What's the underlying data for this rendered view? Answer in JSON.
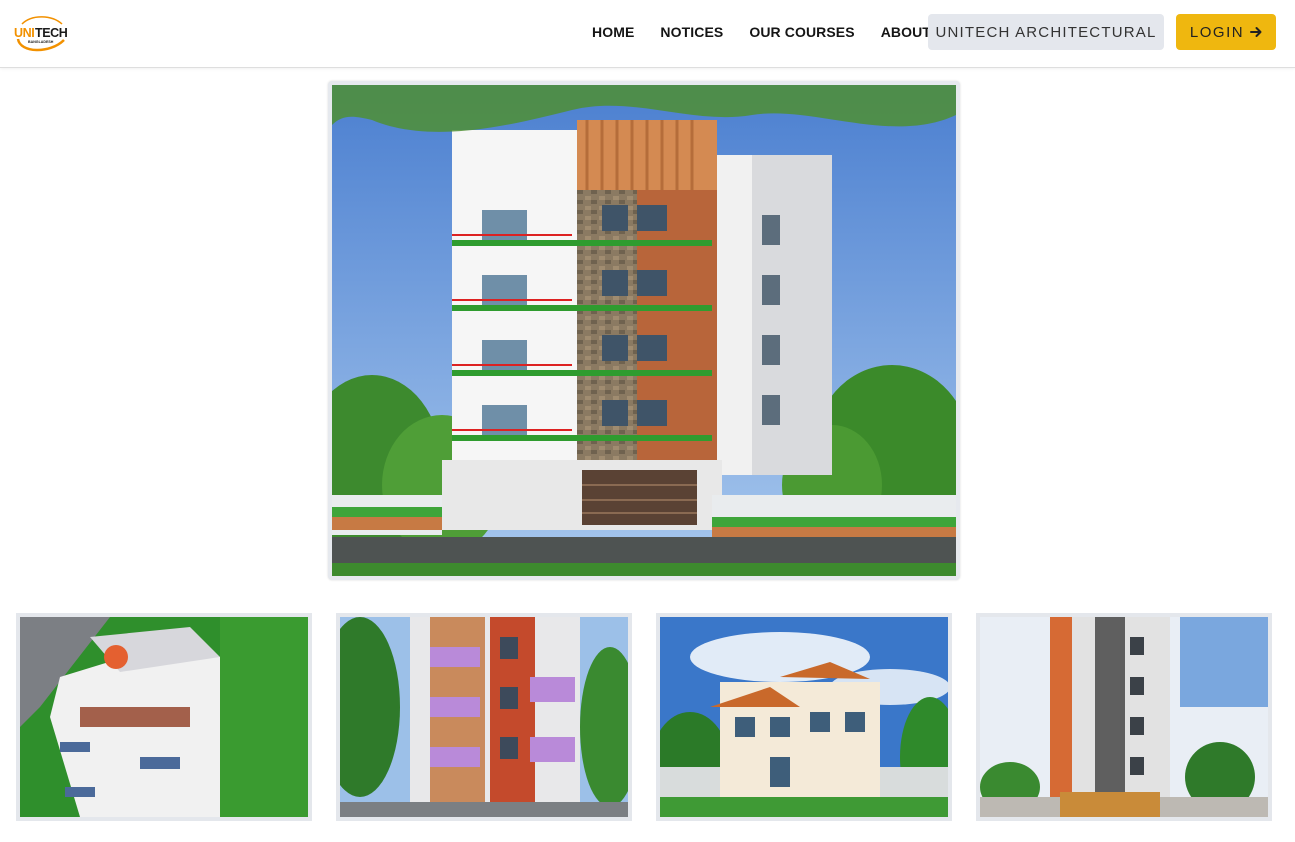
{
  "brand": {
    "logo_text": "UNITECH",
    "logo_subtext": "BANGLADESH",
    "logo_color": "#f29100",
    "logo_dark": "#1b1b1b"
  },
  "nav": {
    "links": [
      {
        "label": "HOME"
      },
      {
        "label": "NOTICES"
      },
      {
        "label": "OUR COURSES"
      },
      {
        "label": "ABOUT"
      }
    ],
    "architectural_button": "UNITECH ARCHITECTURAL",
    "login_button": "LOGIN",
    "login_icon": "arrow-right-icon"
  },
  "colors": {
    "accent": "#efb70f",
    "secondary_button": "#e4e7ed",
    "frame": "#e6e9ee"
  },
  "gallery": {
    "hero": {
      "subject": "multi-storey-apartment-render"
    },
    "thumbnails": [
      {
        "subject": "rooftop-garden-building-render"
      },
      {
        "subject": "colorful-apartment-render"
      },
      {
        "subject": "duplex-house-render"
      },
      {
        "subject": "tall-tower-render"
      }
    ]
  }
}
